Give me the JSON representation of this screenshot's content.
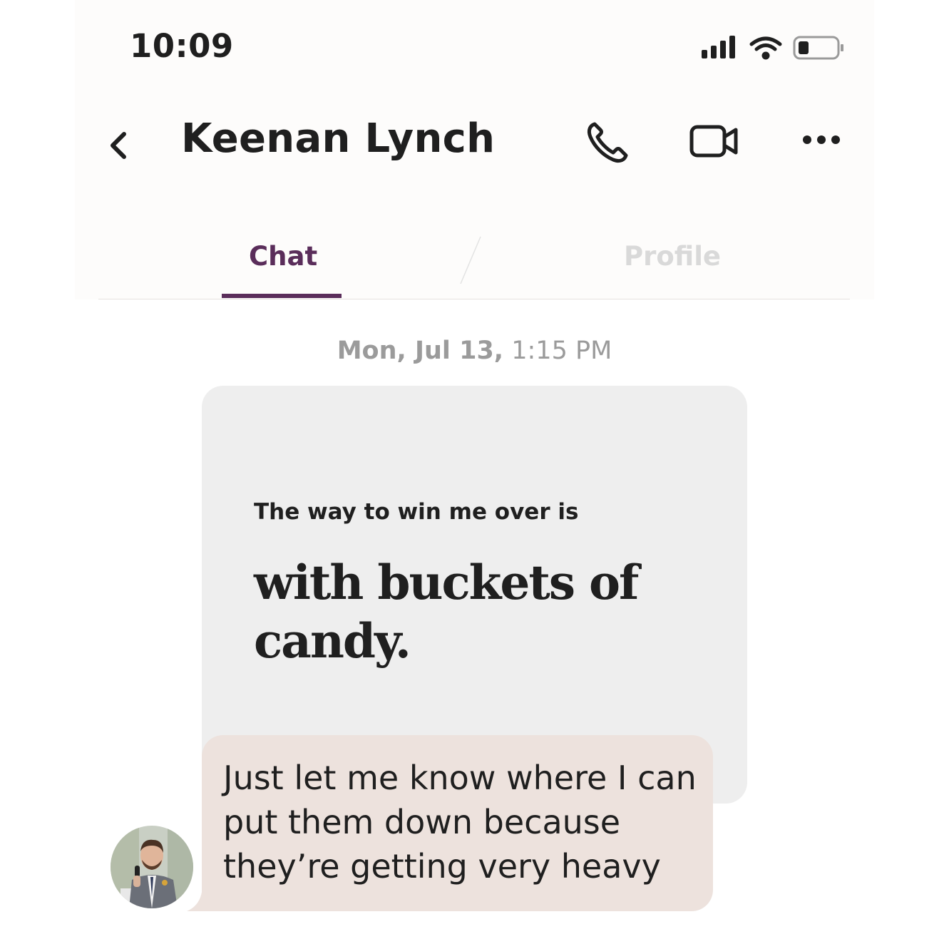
{
  "status_bar": {
    "time": "10:09",
    "icons": [
      "cellular-signal-icon",
      "wifi-icon",
      "battery-icon"
    ]
  },
  "header": {
    "back_icon": "chevron-left-icon",
    "contact_name": "Keenan Lynch",
    "actions": [
      "phone-icon",
      "video-camera-icon",
      "more-icon"
    ]
  },
  "tabs": [
    {
      "label": "Chat",
      "active": true
    },
    {
      "label": "Profile",
      "active": false
    }
  ],
  "colors": {
    "accent": "#5a2d5a",
    "prompt_card": "#eeeeee",
    "message_bubble": "#ede2dd"
  },
  "chat": {
    "date_day": "Mon, Jul 13,",
    "date_time": "1:15 PM",
    "prompt": {
      "question": "The way to win me over is",
      "answer": "with buckets of candy."
    },
    "message": {
      "text": "Just let me know where I can put them down because they’re getting very heavy"
    }
  }
}
